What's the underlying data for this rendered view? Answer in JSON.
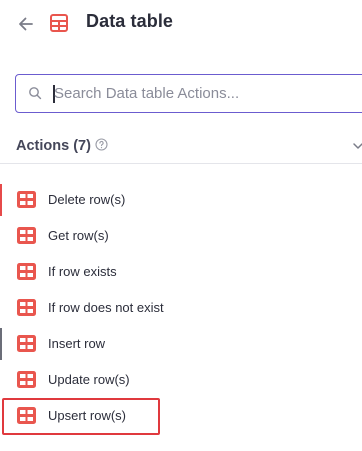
{
  "header": {
    "back_icon": "arrow-left-icon",
    "app_icon": "table-icon",
    "title": "Data table"
  },
  "search": {
    "placeholder": "Search Data table Actions...",
    "value": ""
  },
  "section": {
    "title": "Actions (7)",
    "help_icon": "question-circle-icon",
    "collapse_icon": "chevron-down-icon"
  },
  "actions": [
    {
      "label": "Delete row(s)"
    },
    {
      "label": "Get row(s)"
    },
    {
      "label": "If row exists"
    },
    {
      "label": "If row does not exist"
    },
    {
      "label": "Insert row"
    },
    {
      "label": "Update row(s)"
    },
    {
      "label": "Upsert row(s)"
    }
  ],
  "colors": {
    "accent": "#e9564e",
    "search_border": "#6b5ccf",
    "highlight": "#e0393e"
  }
}
